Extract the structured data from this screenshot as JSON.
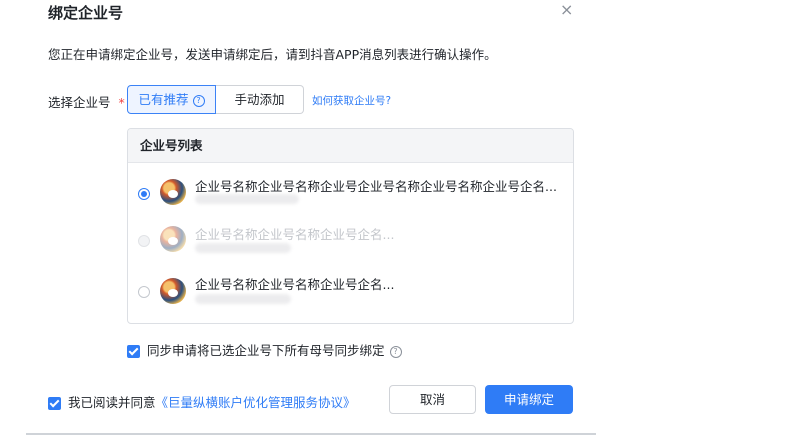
{
  "dialog": {
    "title": "绑定企业号",
    "close_icon": "×",
    "description": "您正在申请绑定企业号，发送申请绑定后，请到抖音APP消息列表进行确认操作。"
  },
  "select": {
    "label": "选择企业号",
    "required_mark": "*",
    "tabs": [
      {
        "label": "已有推荐",
        "active": true,
        "help_icon": "?"
      },
      {
        "label": "手动添加",
        "active": false
      }
    ],
    "how_to_link": "如何获取企业号?"
  },
  "list": {
    "header": "企业号列表",
    "items": [
      {
        "name": "企业号名称企业号名称企业号企业号名称企业号名称企业号企名...",
        "selected": true,
        "disabled": false
      },
      {
        "name": "企业号名称企业号名称企业号企名...",
        "selected": false,
        "disabled": true
      },
      {
        "name": "企业号名称企业号名称企业号企名...",
        "selected": false,
        "disabled": false
      }
    ]
  },
  "sync": {
    "label": "同步申请将已选企业号下所有母号同步绑定",
    "checked": true,
    "help_icon": "?"
  },
  "agreement": {
    "prefix": "我已阅读并同意",
    "link": "《巨量纵横账户优化管理服务协议》",
    "checked": true
  },
  "actions": {
    "cancel_label": "取消",
    "apply_label": "申请绑定"
  },
  "colors": {
    "accent": "#2f7cf6",
    "required": "#f04545"
  }
}
